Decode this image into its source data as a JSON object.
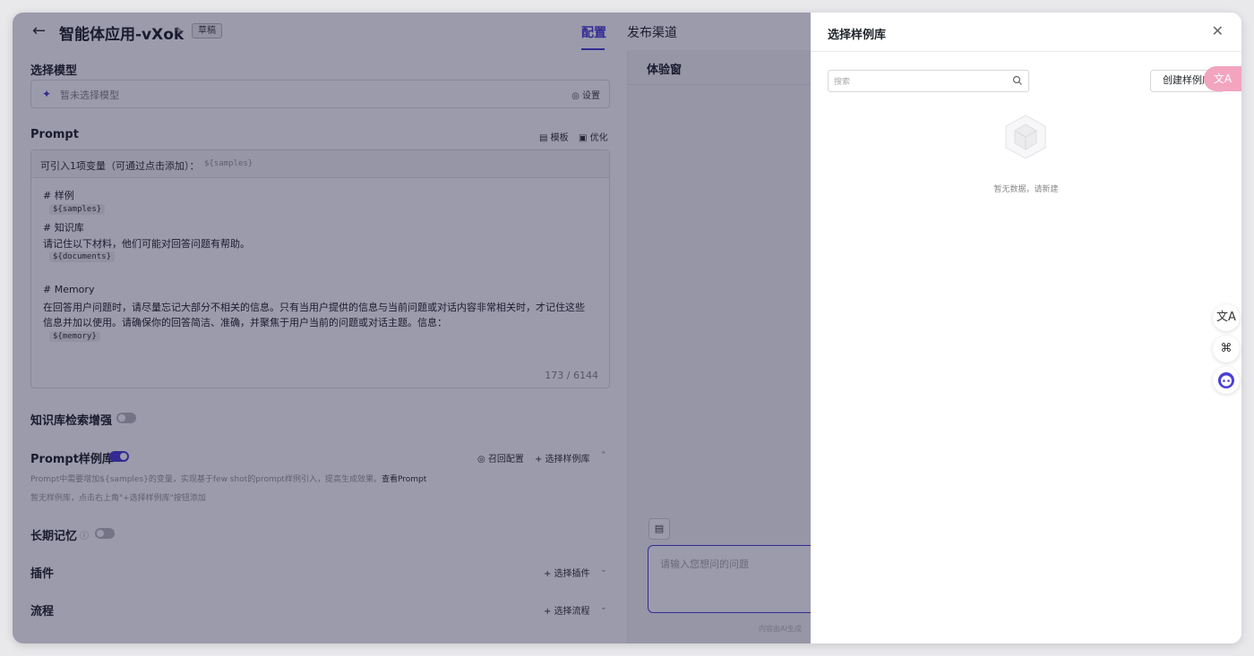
{
  "header": {
    "title": "智能体应用-vXok",
    "draft_badge": "草稿",
    "tabs": [
      {
        "label": "配置",
        "active": true
      },
      {
        "label": "发布渠道",
        "active": false
      }
    ]
  },
  "model_section": {
    "title": "选择模型",
    "placeholder": "暂未选择模型",
    "settings_label": "设置"
  },
  "prompt_section": {
    "title": "Prompt",
    "template_label": "模板",
    "optimize_label": "优化",
    "variable_hint": "可引入1项变量（可通过点击添加）：",
    "variable_chip": "${samples}",
    "lines": {
      "l1": "# 样例",
      "v1": "${samples}",
      "l2": "# 知识库",
      "l3": "请记住以下材料，他们可能对回答问题有帮助。",
      "v2": "${documents}",
      "l4": "# Memory",
      "l5": "在回答用户问题时，请尽量忘记大部分不相关的信息。只有当用户提供的信息与当前问题或对话内容非常相关时，才记住这些",
      "l6": "信息并加以使用。请确保你的回答简洁、准确，并聚焦于用户当前的问题或对话主题。信息：",
      "v3": "${memory}"
    },
    "char_count": "173 / 6144"
  },
  "knowledge_section": {
    "title": "知识库检索增强",
    "enabled": false
  },
  "sample_lib_section": {
    "title": "Prompt样例库",
    "enabled": true,
    "recall_label": "召回配置",
    "select_label": "选择样例库",
    "hint": "Prompt中需要增加${samples}的变量，实现基于few shot的prompt样例引入，提高生成效果。",
    "hint_link": "查看Prompt",
    "empty_hint": "暂无样例库，点击右上角\"+选择样例库\"按钮添加"
  },
  "memory_section": {
    "title": "长期记忆",
    "enabled": false
  },
  "plugin_section": {
    "title": "插件",
    "select_label": "选择插件"
  },
  "flow_section": {
    "title": "流程",
    "select_label": "选择流程"
  },
  "test_window": {
    "title": "体验窗",
    "input_placeholder": "请输入您想问的问题",
    "disclaimer": "内容由AI生成"
  },
  "drawer": {
    "title": "选择样例库",
    "search_placeholder": "搜索",
    "create_label": "创建样例库",
    "empty_text": "暂无数据，请新建"
  },
  "float_tools": {
    "translate_label": "文A",
    "apps_label": "⌘"
  },
  "colors": {
    "accent": "#4a3fd6",
    "overlay": "rgba(20,16,56,0.42)",
    "float_pink": "#f3a4be"
  }
}
